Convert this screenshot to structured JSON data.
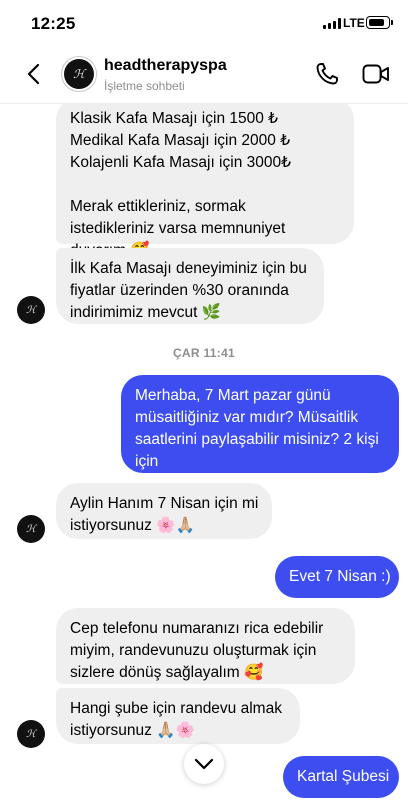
{
  "status_bar": {
    "time": "12:25",
    "network": "LTE",
    "battery_level": 0.85
  },
  "header": {
    "name": "headtherapyspa",
    "subtitle": "İşletme sohbeti"
  },
  "messages": {
    "m1": {
      "lines": [
        "Klasik Kafa Masajı için 1500 ₺",
        "Medikal Kafa Masajı için 2000 ₺",
        "Kolajenli Kafa Masajı için 3000₺",
        "",
        "Merak ettikleriniz, sormak",
        "istedikleriniz varsa memnuniyet",
        "duyarım 🥰"
      ]
    },
    "m2": {
      "lines": [
        "İlk Kafa Masajı deneyiminiz için bu",
        "fiyatlar üzerinden %30 oranında",
        "indirimimiz mevcut 🌿"
      ]
    },
    "timestamp": "ÇAR 11:41",
    "m3": {
      "lines": [
        "Merhaba, 7 Mart pazar günü",
        "müsaitliğiniz var mıdır? Müsaitlik",
        "saatlerini paylaşabilir misiniz? 2 kişi",
        "için"
      ]
    },
    "m4": {
      "lines": [
        "Aylin Hanım 7 Nisan için mi",
        "istiyorsunuz 🌸🙏🏼"
      ]
    },
    "m5": {
      "lines": [
        "Evet 7 Nisan :)"
      ]
    },
    "m6": {
      "lines": [
        "Cep telefonu numaranızı rica edebilir",
        "miyim, randevunuzu oluşturmak için",
        "sizlere dönüş sağlayalım 🥰"
      ]
    },
    "m7": {
      "lines": [
        "Hangi şube için randevu almak",
        "istiyorsunuz 🙏🏼🌸"
      ]
    },
    "m8": {
      "lines": [
        "Kartal Şubesi"
      ]
    }
  },
  "colors": {
    "outgoing": "#3d4df0",
    "incoming": "#efefef",
    "muted": "#8e8e8e"
  },
  "icons": [
    "back-icon",
    "phone-icon",
    "video-icon",
    "chevron-down-icon"
  ]
}
